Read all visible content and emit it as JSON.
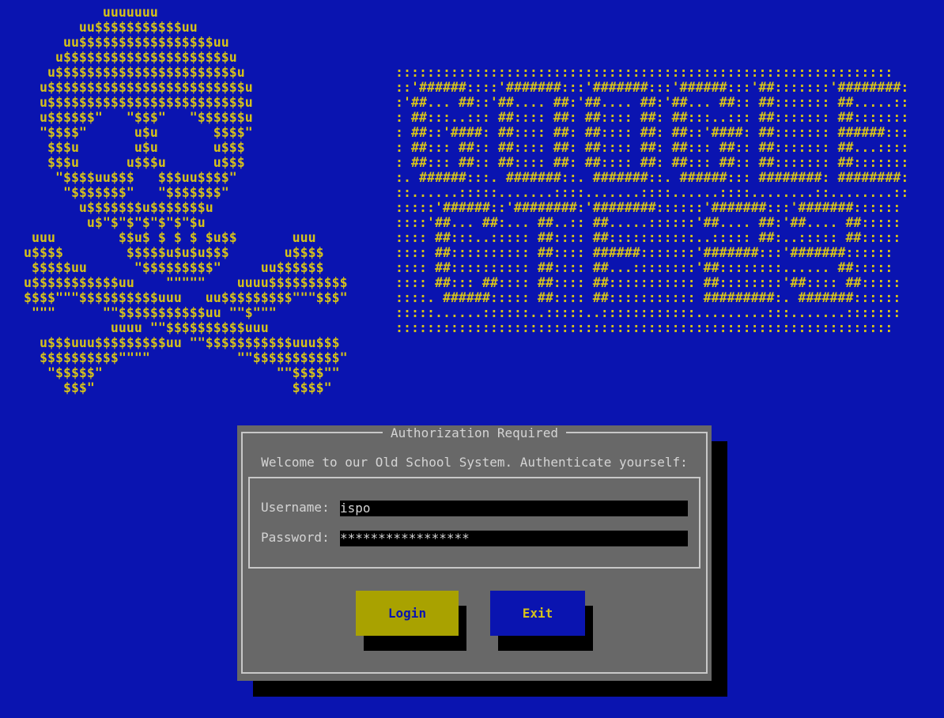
{
  "skull_art": [
    "          uuuuuuu",
    "       uu$$$$$$$$$$$uu",
    "     uu$$$$$$$$$$$$$$$$$uu",
    "    u$$$$$$$$$$$$$$$$$$$$$u",
    "   u$$$$$$$$$$$$$$$$$$$$$$$u",
    "  u$$$$$$$$$$$$$$$$$$$$$$$$$u",
    "  u$$$$$$$$$$$$$$$$$$$$$$$$$u",
    "  u$$$$$$\"   \"$$$\"   \"$$$$$$u",
    "  \"$$$$\"      u$u       $$$$\"",
    "   $$$u       u$u       u$$$",
    "   $$$u      u$$$u      u$$$",
    "    \"$$$$uu$$$   $$$uu$$$$\"",
    "     \"$$$$$$$\"   \"$$$$$$$\"",
    "       u$$$$$$$u$$$$$$$u",
    "        u$\"$\"$\"$\"$\"$\"$u",
    " uuu        $$u$ $ $ $ $u$$       uuu",
    "u$$$$        $$$$$u$u$u$$$       u$$$$",
    " $$$$$uu      \"$$$$$$$$$\"     uu$$$$$$",
    "u$$$$$$$$$$$uu    \"\"\"\"\"    uuuu$$$$$$$$$$",
    "$$$$\"\"\"$$$$$$$$$$uuu   uu$$$$$$$$$\"\"\"$$$\"",
    " \"\"\"      \"\"$$$$$$$$$$$uu \"\"$\"\"\"",
    "           uuuu \"\"$$$$$$$$$$uuu",
    "  u$$$uuu$$$$$$$$$uu \"\"$$$$$$$$$$$uuu$$$",
    "  $$$$$$$$$$\"\"\"\"           \"\"$$$$$$$$$$$\"",
    "   \"$$$$$\"                      \"\"$$$$\"\"",
    "     $$$\"                         $$$$\""
  ],
  "banner_art": [
    ":::::::::::::::::::::::::::::::::::::::::::::::::::::::::::::::",
    "::'######::::'#######:::'#######:::'######:::'##:::::::'########:",
    ":'##... ##::'##.... ##:'##.... ##:'##... ##:: ##::::::: ##.....::",
    ": ##:::..::: ##:::: ##: ##:::: ##: ##:::..::: ##::::::: ##:::::::",
    ": ##::'####: ##:::: ##: ##:::: ##: ##::'####: ##::::::: ######:::",
    ": ##::: ##:: ##:::: ##: ##:::: ##: ##::: ##:: ##::::::: ##...::::",
    ": ##::: ##:: ##:::: ##: ##:::: ##: ##::: ##:: ##::::::: ##:::::::",
    ":. ######:::. #######::. #######::. ######::: ########: ########:",
    "::......:::::.......::::.......::::......::::........::........::",
    ":::::'######::'########:'########::::::'#######:::'#######::::::",
    "::::'##... ##:... ##..:: ##.....::::::'##.... ##:'##.... ##:::::",
    ":::: ##:::..::::: ##:::: ##:::::::::::..::::: ##:..::::: ##:::::",
    ":::: ##:::::::::: ##:::: ######:::::::'#######:::'#######::::::",
    ":::: ##:::::::::: ##:::: ##...::::::::'##::::::::...... ##:::::",
    ":::: ##::: ##:::: ##:::: ##::::::::::: ##::::::::'##:::: ##:::::",
    "::::. ######::::: ##:::: ##::::::::::: #########:. #######::::::",
    ":::::......::::::..:::::..::::::::::::.........:::.......:::::::",
    ":::::::::::::::::::::::::::::::::::::::::::::::::::::::::::::::"
  ],
  "dialog": {
    "title": "Authorization Required",
    "welcome": "Welcome to our Old School System. Authenticate yourself:",
    "username_label": "Username:",
    "username_value": "ispo",
    "password_label": "Password:",
    "password_value": "*****************",
    "login_label": "Login",
    "exit_label": "Exit"
  },
  "colors": {
    "background": "#0a14b0",
    "art": "#d6c21a",
    "dialog": "#686868",
    "login_button": "#a9a200",
    "exit_button": "#0a14b0"
  }
}
